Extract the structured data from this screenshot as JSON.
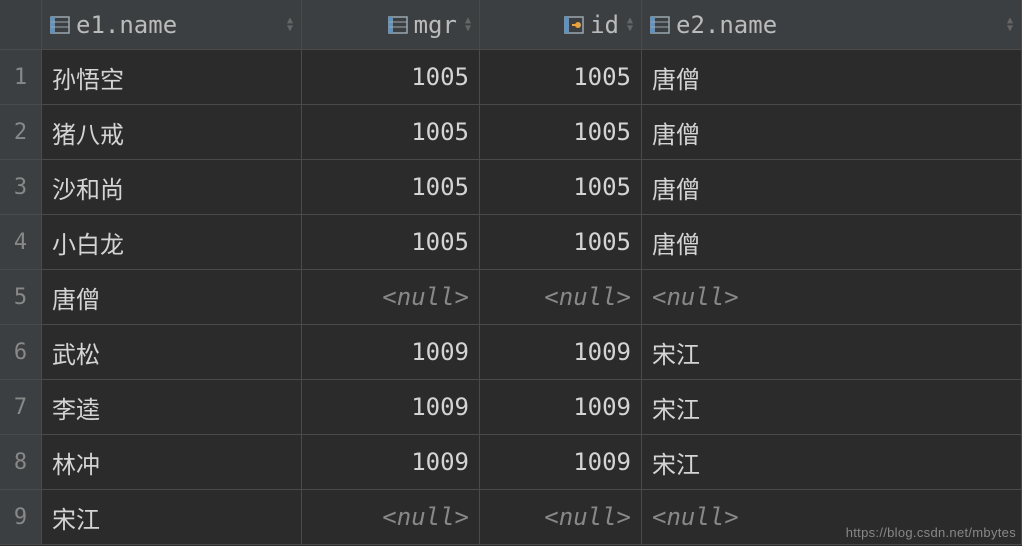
{
  "columns": [
    {
      "key": "e1name",
      "label": "e1.name",
      "icon": "table-col-icon",
      "align": "left"
    },
    {
      "key": "mgr",
      "label": "mgr",
      "icon": "table-col-icon",
      "align": "right"
    },
    {
      "key": "id",
      "label": "id",
      "icon": "key-col-icon",
      "align": "right"
    },
    {
      "key": "e2name",
      "label": "e2.name",
      "icon": "table-col-icon",
      "align": "left"
    }
  ],
  "rows": [
    {
      "num": "1",
      "e1name": "孙悟空",
      "mgr": "1005",
      "id": "1005",
      "e2name": "唐僧",
      "mgr_null": false,
      "id_null": false,
      "e2_null": false
    },
    {
      "num": "2",
      "e1name": "猪八戒",
      "mgr": "1005",
      "id": "1005",
      "e2name": "唐僧",
      "mgr_null": false,
      "id_null": false,
      "e2_null": false
    },
    {
      "num": "3",
      "e1name": "沙和尚",
      "mgr": "1005",
      "id": "1005",
      "e2name": "唐僧",
      "mgr_null": false,
      "id_null": false,
      "e2_null": false
    },
    {
      "num": "4",
      "e1name": "小白龙",
      "mgr": "1005",
      "id": "1005",
      "e2name": "唐僧",
      "mgr_null": false,
      "id_null": false,
      "e2_null": false
    },
    {
      "num": "5",
      "e1name": "唐僧",
      "mgr": "<null>",
      "id": "<null>",
      "e2name": "<null>",
      "mgr_null": true,
      "id_null": true,
      "e2_null": true
    },
    {
      "num": "6",
      "e1name": "武松",
      "mgr": "1009",
      "id": "1009",
      "e2name": "宋江",
      "mgr_null": false,
      "id_null": false,
      "e2_null": false
    },
    {
      "num": "7",
      "e1name": "李逵",
      "mgr": "1009",
      "id": "1009",
      "e2name": "宋江",
      "mgr_null": false,
      "id_null": false,
      "e2_null": false
    },
    {
      "num": "8",
      "e1name": "林冲",
      "mgr": "1009",
      "id": "1009",
      "e2name": "宋江",
      "mgr_null": false,
      "id_null": false,
      "e2_null": false
    },
    {
      "num": "9",
      "e1name": "宋江",
      "mgr": "<null>",
      "id": "<null>",
      "e2name": "<null>",
      "mgr_null": true,
      "id_null": true,
      "e2_null": true
    }
  ],
  "watermark": "https://blog.csdn.net/mbytes"
}
